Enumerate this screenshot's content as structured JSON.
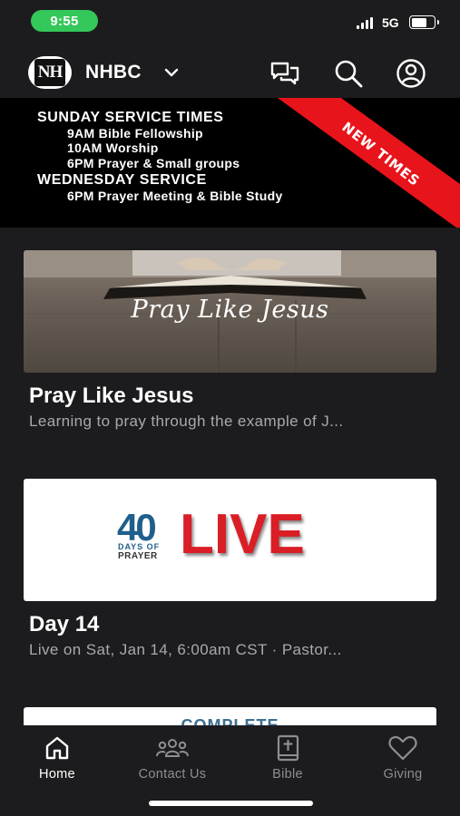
{
  "status_bar": {
    "time": "9:55",
    "network": "5G"
  },
  "header": {
    "logo_text": "NH",
    "org_name": "NHBC",
    "icons": [
      "chat-icon",
      "search-icon",
      "account-icon"
    ]
  },
  "banner": {
    "sunday_heading": "SUNDAY SERVICE TIMES",
    "sunday_items": [
      "9AM Bible Fellowship",
      "10AM Worship",
      "6PM Prayer & Small groups"
    ],
    "wednesday_heading": "WEDNESDAY SERVICE",
    "wednesday_items": [
      "6PM Prayer Meeting & Bible Study"
    ],
    "ribbon_text": "NEW TIMES",
    "ribbon_color": "#e8141b"
  },
  "cards": [
    {
      "image_text": "Pray Like Jesus",
      "title": "Pray Like Jesus",
      "subtitle": "Learning to pray through the example of J..."
    },
    {
      "image_numeral": "40",
      "image_small_1": "DAYS OF",
      "image_small_2": "PRAYER",
      "image_live": "LIVE",
      "title": "Day 14",
      "subtitle": "Live on Sat, Jan 14, 6:00am CST · Pastor..."
    },
    {
      "image_text": "COMPLETE"
    }
  ],
  "tabs": [
    {
      "label": "Home",
      "icon": "home-icon",
      "active": true
    },
    {
      "label": "Contact Us",
      "icon": "people-icon",
      "active": false
    },
    {
      "label": "Bible",
      "icon": "bible-icon",
      "active": false
    },
    {
      "label": "Giving",
      "icon": "heart-icon",
      "active": false
    }
  ],
  "colors": {
    "background": "#1c1c1e",
    "accent_red": "#e8141b",
    "status_green": "#34c759",
    "live_red": "#d91e25",
    "forty_blue": "#1f5f8b"
  }
}
